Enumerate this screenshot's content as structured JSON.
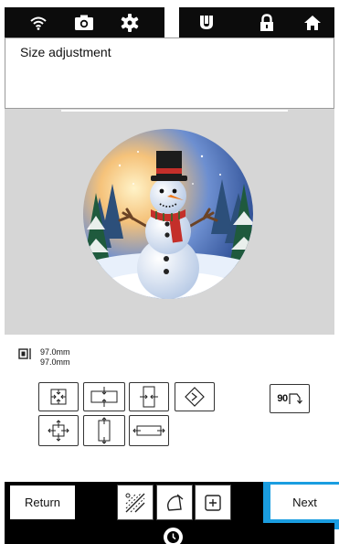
{
  "header": {
    "status_icons": [
      "wifi-icon",
      "camera-icon",
      "gear-icon"
    ],
    "nav_icons": [
      "embroidery-foot-icon",
      "lock-icon",
      "home-icon"
    ]
  },
  "title": "Size adjustment",
  "preview": {
    "image": "snowman-artwork",
    "background_color": "#d6d6d6"
  },
  "dimensions": {
    "width": "97.0mm",
    "height": "97.0mm"
  },
  "controls": {
    "buttons": [
      "reduce-proportional-button",
      "reduce-width-button",
      "reduce-height-button",
      "density-button",
      "rotate-90-button",
      "enlarge-proportional-button",
      "enlarge-height-button",
      "enlarge-width-button"
    ],
    "rotate_label": "90"
  },
  "footer": {
    "return_label": "Return",
    "next_label": "Next",
    "accent_color": "#1a9de0"
  }
}
